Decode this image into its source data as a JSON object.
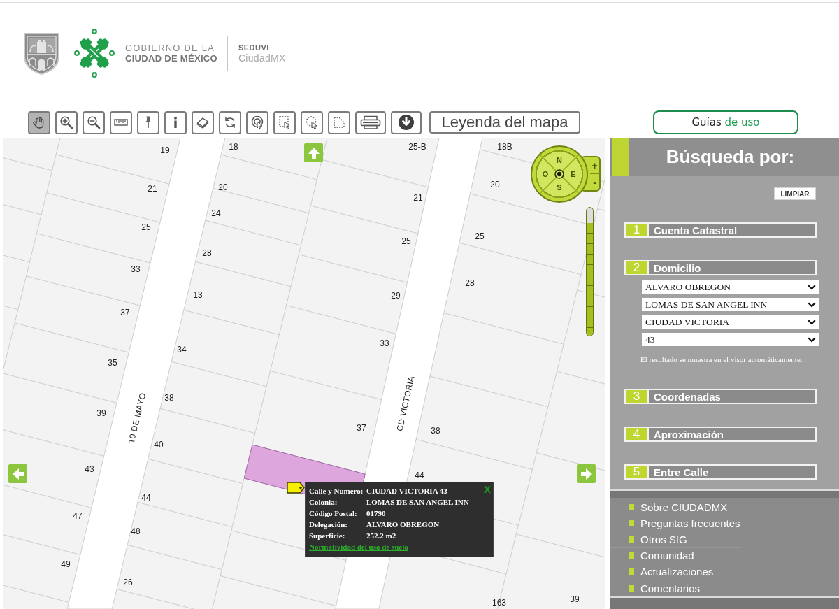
{
  "header": {
    "org_name": [
      "GOBIERNO DE LA",
      "CIUDAD DE MÉXICO"
    ],
    "agency": "SEDUVI",
    "app_name": "CiudadMX"
  },
  "toolbar": {
    "tools": [
      {
        "selected": true
      },
      {
        "selected": false
      },
      {
        "selected": false
      },
      {
        "selected": false
      },
      {
        "selected": false
      },
      {
        "selected": false
      },
      {
        "selected": false
      },
      {
        "selected": false
      },
      {
        "selected": false
      },
      {
        "selected": false
      },
      {
        "selected": false
      },
      {
        "selected": false
      },
      {
        "selected": false
      },
      {
        "selected": false
      }
    ],
    "legend_button": "Leyenda del mapa"
  },
  "guides_button": {
    "label": "Guías",
    "accent_label": "de uso"
  },
  "map": {
    "streets": [
      "10 DE MAYO",
      "CD VICTORIA"
    ],
    "lot_numbers": [
      "19",
      "18",
      "25-B",
      "18B",
      "21",
      "20",
      "20",
      "21",
      "24",
      "25",
      "25",
      "25",
      "28",
      "33",
      "28",
      "13",
      "29",
      "37",
      "34",
      "33",
      "35",
      "38",
      "39",
      "37",
      "38",
      "40",
      "43",
      "44",
      "44",
      "47",
      "48",
      "49",
      "26",
      "163",
      "39"
    ],
    "compass": {
      "north": "N",
      "west": "O",
      "east": "E",
      "south": "S"
    },
    "zoom_in": "+",
    "zoom_out": "-",
    "zoom_slider": {
      "level": 0.88
    },
    "popup": {
      "fields": [
        {
          "label": "Calle y Número:",
          "value": "CIUDAD VICTORIA 43"
        },
        {
          "label": "Colonia:",
          "value": "LOMAS DE SAN ANGEL INN"
        },
        {
          "label": "Código Postal:",
          "value": "01790"
        },
        {
          "label": "Delegación:",
          "value": "ALVARO OBREGON"
        },
        {
          "label": "Superficie:",
          "value": "252.2 m2"
        }
      ],
      "link": "Normatividad del uso de suelo",
      "close": "X"
    }
  },
  "search_panel": {
    "title": "Búsqueda por:",
    "clear_button": "LIMPIAR",
    "sections": [
      {
        "number": "1",
        "label": "Cuenta Catastral"
      },
      {
        "number": "2",
        "label": "Domicilio",
        "selects": [
          "ALVARO OBREGON",
          "LOMAS DE SAN ANGEL INN",
          "CIUDAD VICTORIA",
          "43"
        ],
        "note": "El resultado se muestra en el visor automáticamente."
      },
      {
        "number": "3",
        "label": "Coordenadas"
      },
      {
        "number": "4",
        "label": "Aproximación"
      },
      {
        "number": "5",
        "label": "Entre Calle"
      }
    ]
  },
  "links": [
    "Sobre CIUDADMX",
    "Preguntas frecuentes",
    "Otros SIG",
    "Comunidad",
    "Actualizaciones",
    "Comentarios"
  ]
}
